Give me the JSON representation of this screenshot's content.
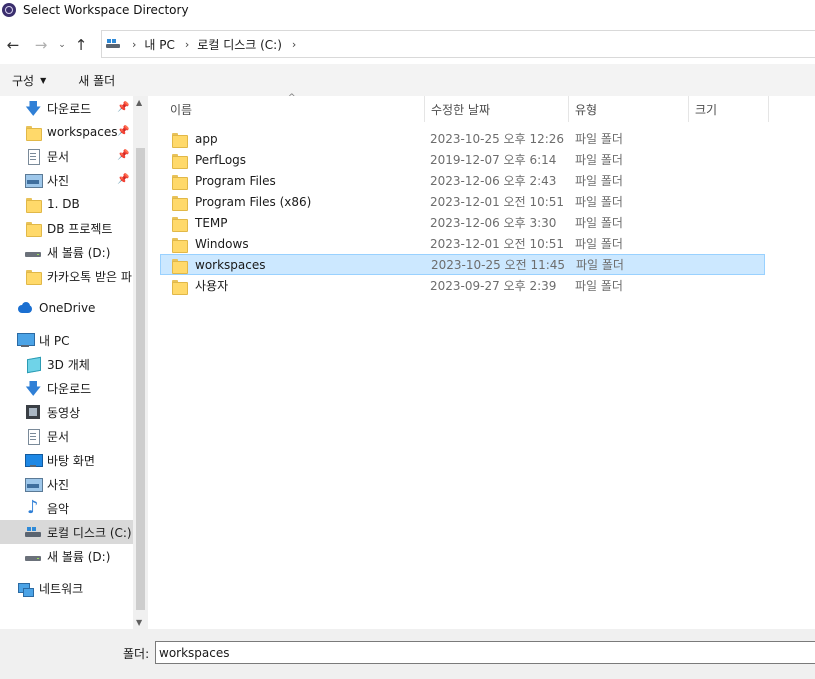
{
  "window": {
    "title": "Select Workspace Directory"
  },
  "address": {
    "crumbs": [
      "내 PC",
      "로컬 디스크 (C:)"
    ]
  },
  "commandbar": {
    "organize": "구성",
    "new_folder": "새 폴더"
  },
  "nav": {
    "items": [
      {
        "label": "다운로드",
        "icon": "download-icon",
        "pinned": true
      },
      {
        "label": "workspaces",
        "icon": "folder-icon",
        "pinned": true
      },
      {
        "label": "문서",
        "icon": "document-icon",
        "pinned": true
      },
      {
        "label": "사진",
        "icon": "pictures-icon",
        "pinned": true
      },
      {
        "label": "1. DB",
        "icon": "folder-icon",
        "pinned": false
      },
      {
        "label": "DB 프로젝트",
        "icon": "folder-icon",
        "pinned": false
      },
      {
        "label": "새 볼륨 (D:)",
        "icon": "drive-icon",
        "pinned": false
      },
      {
        "label": "카카오톡 받은 파",
        "icon": "folder-icon",
        "pinned": false
      },
      {
        "label": "OneDrive",
        "icon": "onedrive-icon",
        "pinned": false
      },
      {
        "label": "내 PC",
        "icon": "this-pc-icon",
        "pinned": false
      },
      {
        "label": "3D 개체",
        "icon": "3d-objects-icon",
        "pinned": false
      },
      {
        "label": "다운로드",
        "icon": "download-icon",
        "pinned": false
      },
      {
        "label": "동영상",
        "icon": "videos-icon",
        "pinned": false
      },
      {
        "label": "문서",
        "icon": "document-icon",
        "pinned": false
      },
      {
        "label": "바탕 화면",
        "icon": "desktop-icon",
        "pinned": false
      },
      {
        "label": "사진",
        "icon": "pictures-icon",
        "pinned": false
      },
      {
        "label": "음악",
        "icon": "music-icon",
        "pinned": false
      },
      {
        "label": "로컬 디스크 (C:)",
        "icon": "local-disk-icon",
        "pinned": false,
        "selected": true
      },
      {
        "label": "새 볼륨 (D:)",
        "icon": "drive-icon",
        "pinned": false
      },
      {
        "label": "네트워크",
        "icon": "network-icon",
        "pinned": false
      }
    ]
  },
  "columns": {
    "name": "이름",
    "date": "수정한 날짜",
    "type": "유형",
    "size": "크기"
  },
  "files": [
    {
      "name": "app",
      "date": "2023-10-25 오후 12:26",
      "type": "파일 폴더"
    },
    {
      "name": "PerfLogs",
      "date": "2019-12-07 오후 6:14",
      "type": "파일 폴더"
    },
    {
      "name": "Program Files",
      "date": "2023-12-06 오후 2:43",
      "type": "파일 폴더"
    },
    {
      "name": "Program Files (x86)",
      "date": "2023-12-01 오전 10:51",
      "type": "파일 폴더"
    },
    {
      "name": "TEMP",
      "date": "2023-12-06 오후 3:30",
      "type": "파일 폴더"
    },
    {
      "name": "Windows",
      "date": "2023-12-01 오전 10:51",
      "type": "파일 폴더"
    },
    {
      "name": "workspaces",
      "date": "2023-10-25 오전 11:45",
      "type": "파일 폴더",
      "selected": true
    },
    {
      "name": "사용자",
      "date": "2023-09-27 오후 2:39",
      "type": "파일 폴더"
    }
  ],
  "footer": {
    "folder_label": "폴더:",
    "folder_value": "workspaces"
  }
}
